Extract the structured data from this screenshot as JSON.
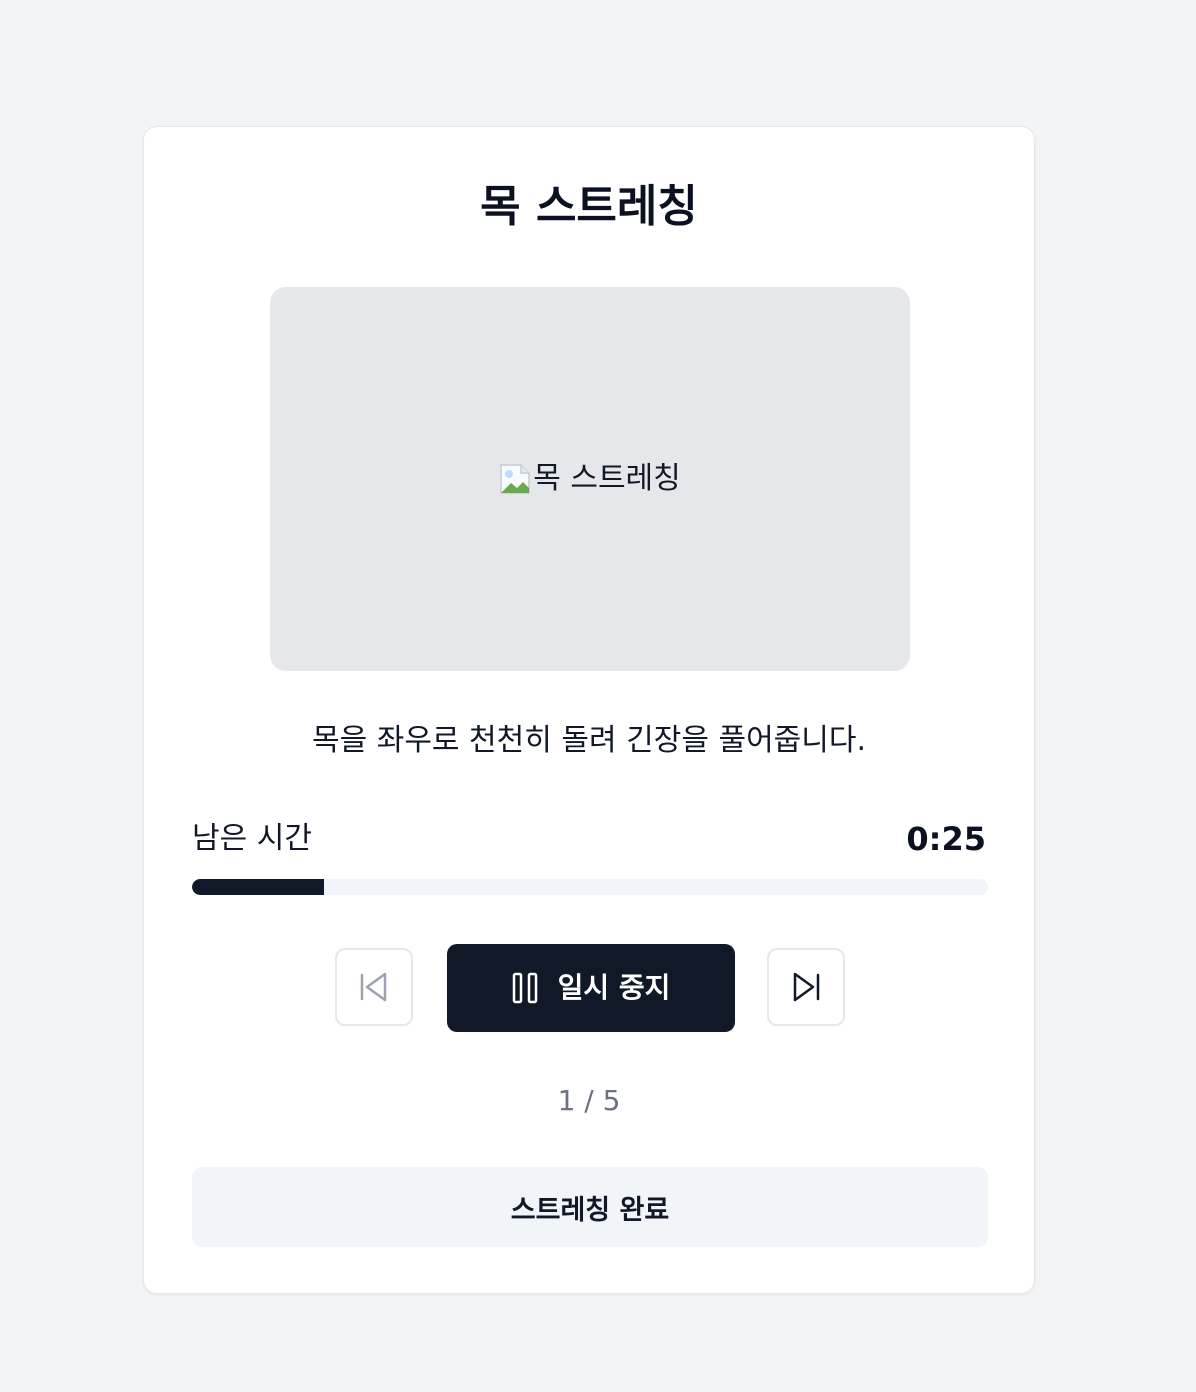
{
  "exercise": {
    "title": "목 스트레칭",
    "image_alt": "목 스트레칭",
    "description": "목을 좌우로 천천히 돌려 긴장을 풀어줍니다."
  },
  "timer": {
    "label": "남은 시간",
    "remaining": "0:25",
    "progress_fraction": 0.166
  },
  "controls": {
    "prev_icon": "skip-back-icon",
    "pause_icon": "pause-icon",
    "pause_label": "일시 중지",
    "next_icon": "skip-forward-icon"
  },
  "counter": "1 / 5",
  "complete_label": "스트레칭 완료",
  "colors": {
    "background": "#f3f4f6",
    "primary": "#111827",
    "track": "#f1f5f9",
    "image_placeholder": "#e5e7eb",
    "muted_text": "#6b7280"
  }
}
